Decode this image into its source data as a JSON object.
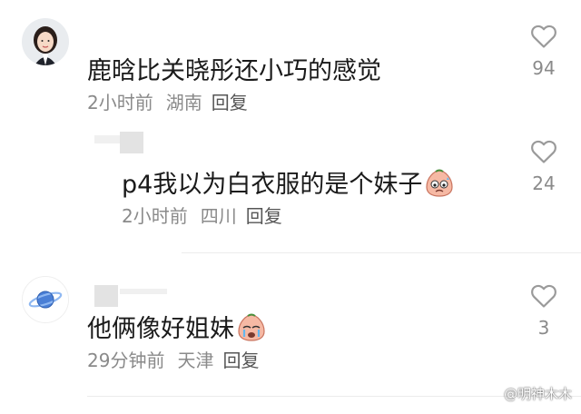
{
  "comments": [
    {
      "text": "鹿晗比关晓彤还小巧的感觉",
      "time": "2小时前",
      "region": "湖南",
      "reply_label": "回复",
      "likes": "94"
    },
    {
      "text": "p4我以为白衣服的是个妹子",
      "time": "2小时前",
      "region": "四川",
      "reply_label": "回复",
      "likes": "24"
    },
    {
      "text": "他俩像好姐妹",
      "time": "29分钟前",
      "region": "天津",
      "reply_label": "回复",
      "likes": "3"
    }
  ],
  "watermark": "@明神木木",
  "icons": {
    "like": "heart-outline-icon",
    "emoji": "crying-face-emoji",
    "avatar_3": "planet-icon"
  }
}
